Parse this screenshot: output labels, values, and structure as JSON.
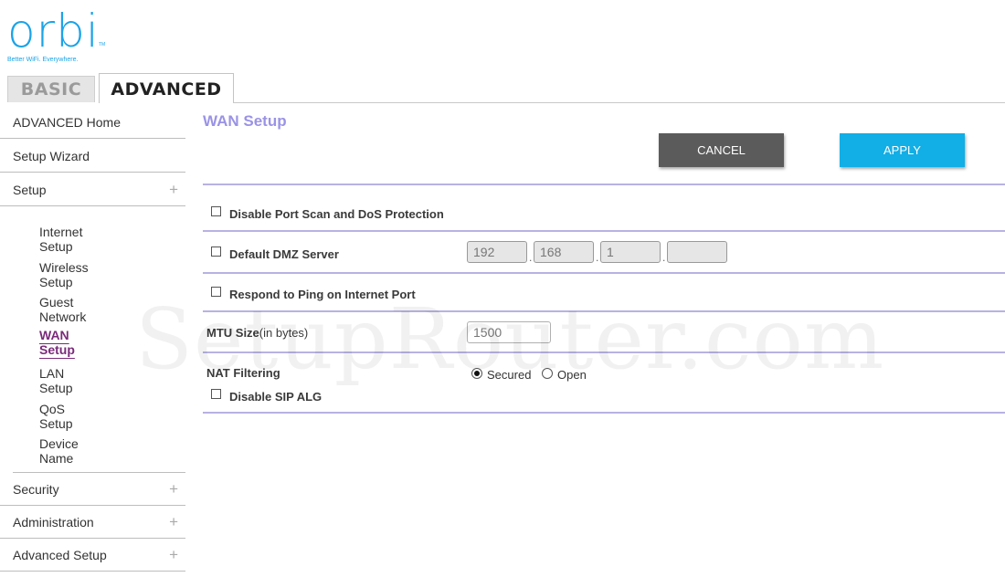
{
  "brand": {
    "logo": "orbi",
    "tm": "TM",
    "tagline": "Better WiFi. Everywhere."
  },
  "tabs": {
    "basic": "BASIC",
    "advanced": "ADVANCED"
  },
  "sidebar": {
    "top_items": [
      {
        "label": "ADVANCED Home"
      },
      {
        "label": "Setup Wizard"
      },
      {
        "label": "Setup",
        "expander": "+"
      }
    ],
    "sub_items": [
      {
        "label": "Internet Setup"
      },
      {
        "label": "Wireless Setup"
      },
      {
        "label": "Guest Network"
      },
      {
        "label": "WAN Setup",
        "active": true
      },
      {
        "label": "LAN Setup"
      },
      {
        "label": "QoS Setup"
      },
      {
        "label": "Device Name"
      }
    ],
    "bottom_items": [
      {
        "label": "Security",
        "expander": "+"
      },
      {
        "label": "Administration",
        "expander": "+"
      },
      {
        "label": "Advanced Setup",
        "expander": "+"
      }
    ]
  },
  "main": {
    "title": "WAN Setup",
    "cancel_label": "CANCEL",
    "apply_label": "APPLY",
    "disable_port_scan": {
      "label": "Disable Port Scan and DoS Protection",
      "checked": false
    },
    "dmz": {
      "label": "Default DMZ Server",
      "checked": false,
      "ip": [
        "192",
        "168",
        "1",
        ""
      ],
      "separator": "."
    },
    "respond_ping": {
      "label": "Respond to Ping on Internet Port",
      "checked": false
    },
    "mtu": {
      "label_bold": "MTU Size",
      "label_light": "(in bytes)",
      "value": "1500"
    },
    "nat": {
      "label": "NAT Filtering",
      "secured_label": "Secured",
      "open_label": "Open",
      "selected": "Secured"
    },
    "sip_alg": {
      "label": "Disable SIP ALG",
      "checked": false
    }
  },
  "watermark": "SetupRouter.com",
  "colors": {
    "brand_blue": "#1ba3e8",
    "title_lavender": "#9a93e6",
    "rule_lavender": "#b7b2e2",
    "apply_blue": "#12aee6",
    "cancel_gray": "#5b5b5b",
    "active_purple": "#7a2a7a"
  }
}
